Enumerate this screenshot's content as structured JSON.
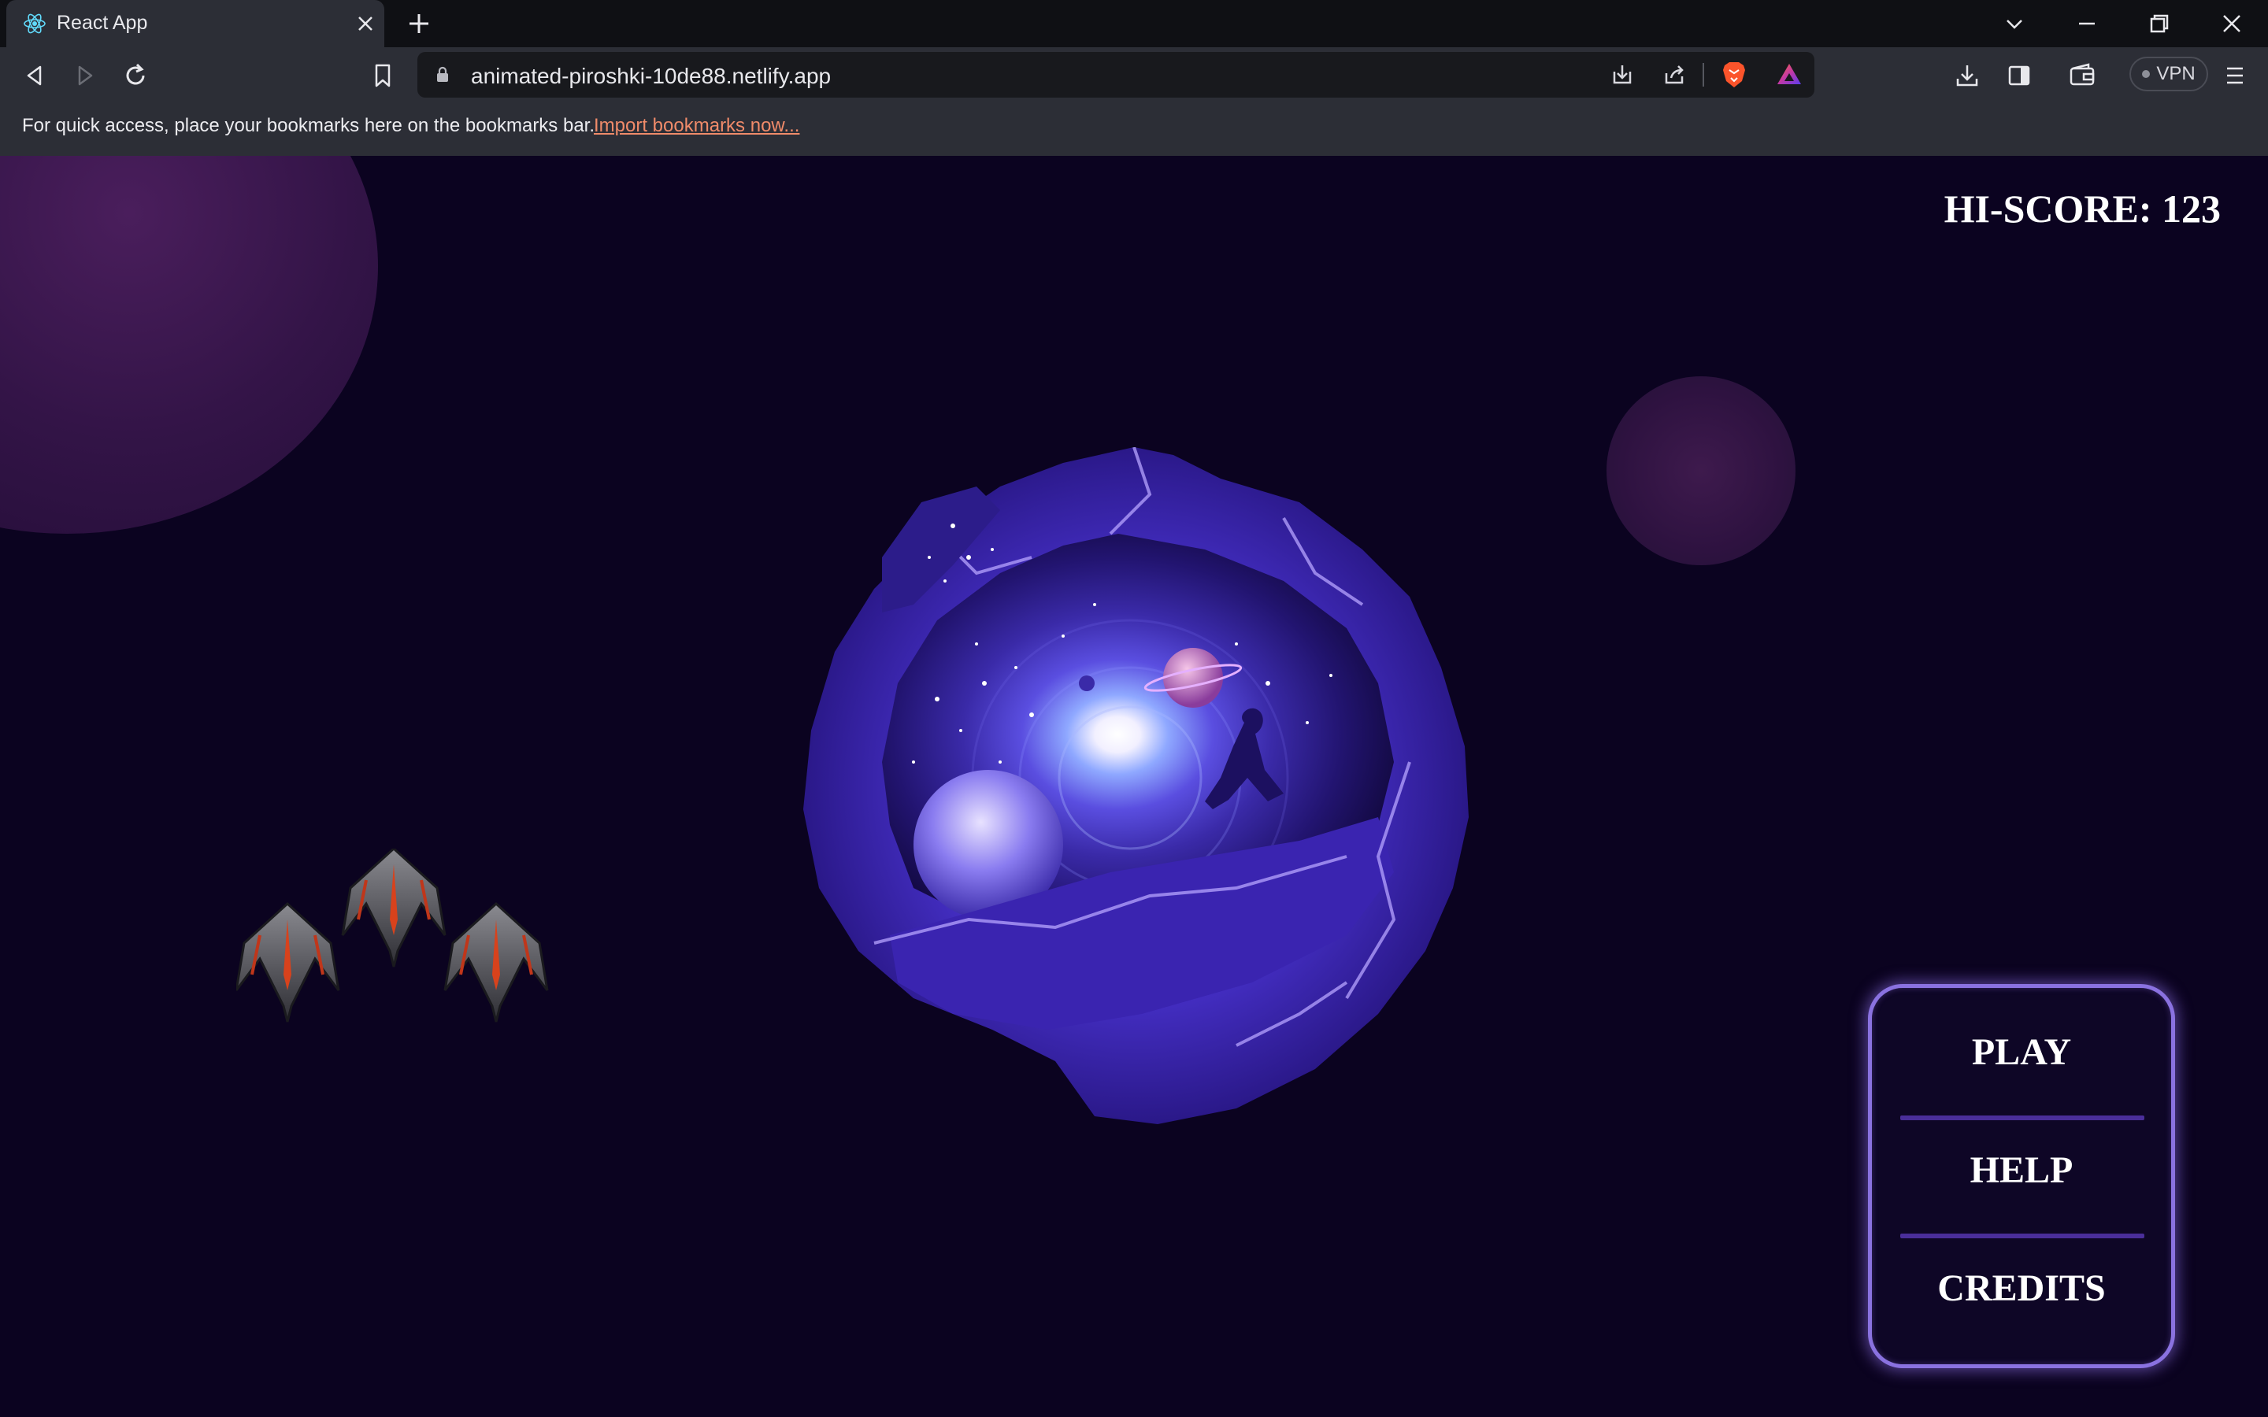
{
  "browser": {
    "tab_title": "React App",
    "url": "animated-piroshki-10de88.netlify.app",
    "vpn_label": "VPN",
    "bookmarks_bar": {
      "message": "For quick access, place your bookmarks here on the bookmarks bar.",
      "link_text": "Import bookmarks now..."
    },
    "icons": {
      "tab_favicon": "react-logo-icon",
      "tab_close": "close-icon",
      "new_tab": "plus-icon",
      "tab_search": "chevron-down-icon",
      "minimize": "minimize-icon",
      "restore": "restore-icon",
      "close_window": "close-icon",
      "back": "back-icon",
      "forward": "forward-icon",
      "reload": "reload-icon",
      "bookmark": "bookmark-icon",
      "lock": "lock-icon",
      "install": "install-icon",
      "share": "share-icon",
      "brave_shield": "brave-lion-icon",
      "brave_rewards": "rewards-triangle-icon",
      "downloads": "download-icon",
      "sidebar": "sidebar-icon",
      "wallet": "wallet-icon",
      "menu": "hamburger-menu-icon"
    }
  },
  "game": {
    "hiscore_text": "HI-SCORE: 123",
    "menu": {
      "play": "PLAY",
      "help": "HELP",
      "credits": "CREDITS"
    },
    "colors": {
      "background": "#0b0320",
      "menu_border": "#8a72e0",
      "menu_divider": "#4a2e9a"
    }
  }
}
